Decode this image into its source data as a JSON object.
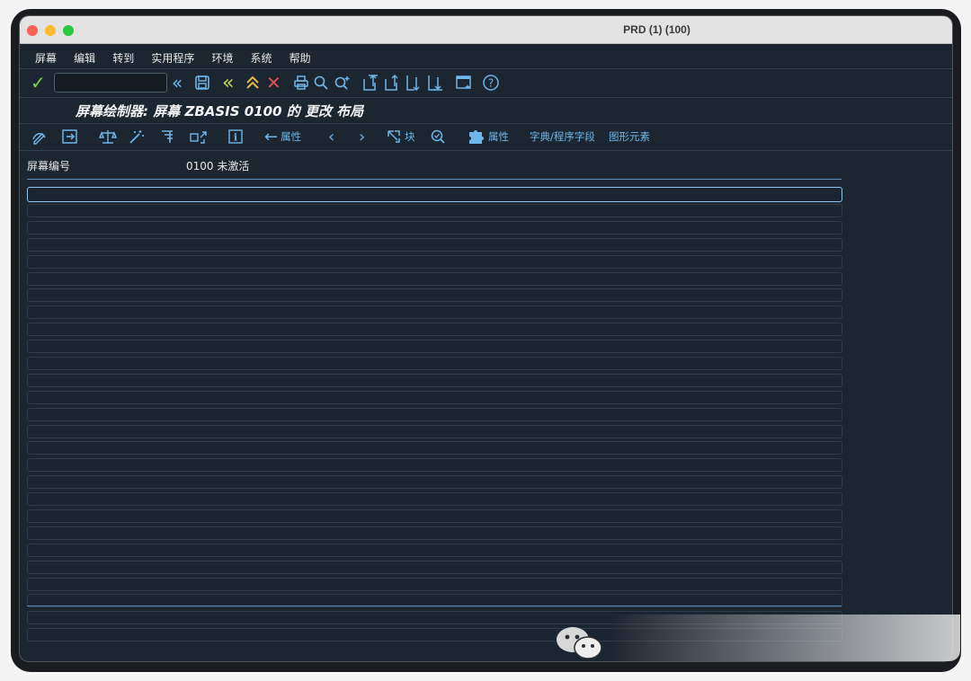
{
  "window": {
    "title": "PRD (1) (100)"
  },
  "menu": [
    "屏幕",
    "编辑",
    "转到",
    "实用程序",
    "环境",
    "系统",
    "帮助"
  ],
  "toolbar": {
    "command_value": "",
    "icons": [
      "check-icon",
      "command-field",
      "back-double-icon",
      "save-icon",
      "back-icon",
      "exit-icon",
      "cancel-icon",
      "print-icon",
      "find-icon",
      "find-next-icon",
      "first-page-icon",
      "previous-page-icon",
      "next-page-icon",
      "last-page-icon",
      "new-window-icon",
      "help-icon"
    ]
  },
  "page": {
    "title": "屏幕绘制器: 屏幕 ZBASIS 0100 的 更改 布局"
  },
  "app_toolbar": {
    "attributes_label_1": "属性",
    "block_label": "块",
    "attributes_label_2": "属性",
    "dict_fields_label": "字典/程序字段",
    "graphic_elements_label": "图形元素"
  },
  "screen_info": {
    "label": "屏幕编号",
    "value": "0100 未激活"
  },
  "colors": {
    "background": "#1c2631",
    "accent": "#6fb6ea",
    "title_text": "#f2f2f2"
  }
}
